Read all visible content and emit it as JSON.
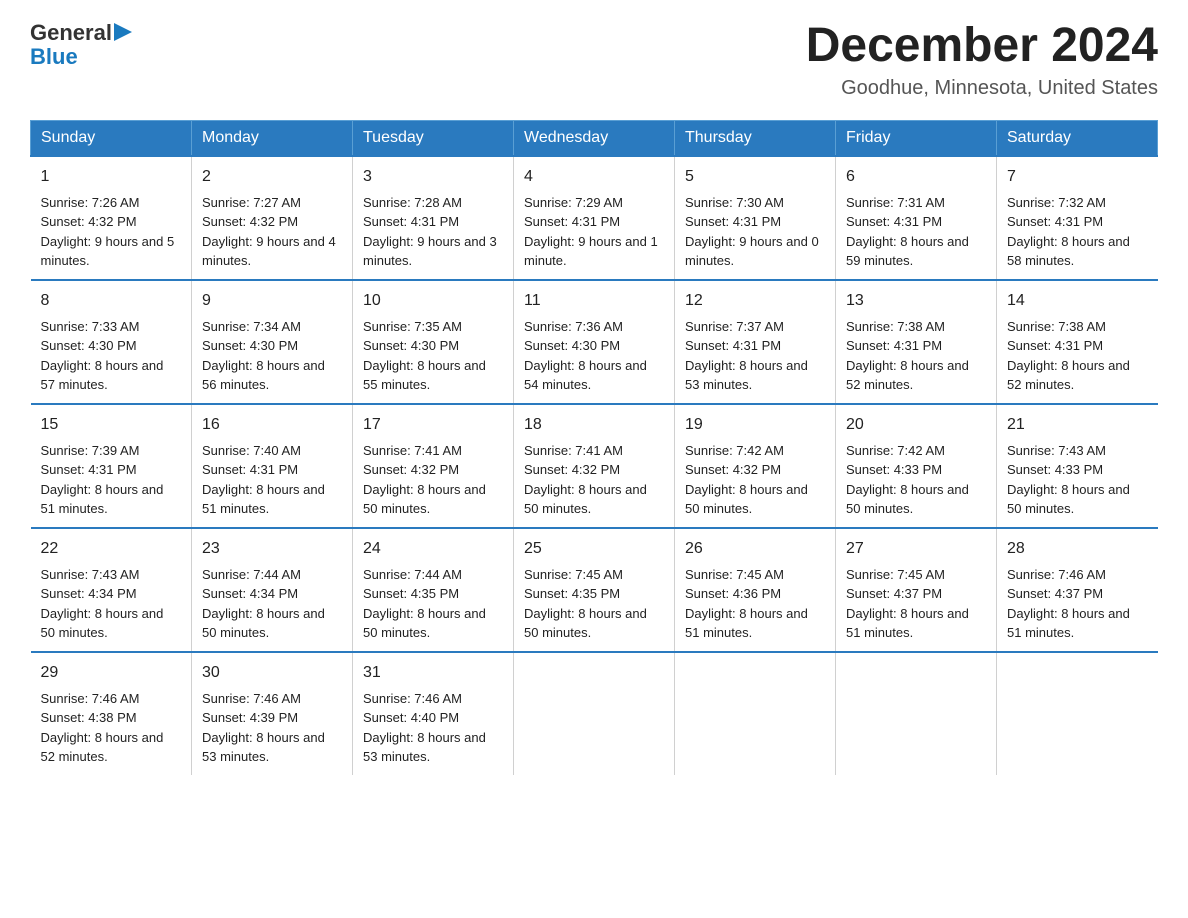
{
  "logo": {
    "general": "General",
    "blue": "Blue",
    "triangle": "▶"
  },
  "title": "December 2024",
  "subtitle": "Goodhue, Minnesota, United States",
  "days_of_week": [
    "Sunday",
    "Monday",
    "Tuesday",
    "Wednesday",
    "Thursday",
    "Friday",
    "Saturday"
  ],
  "weeks": [
    [
      {
        "day": "1",
        "sunrise": "7:26 AM",
        "sunset": "4:32 PM",
        "daylight": "9 hours and 5 minutes."
      },
      {
        "day": "2",
        "sunrise": "7:27 AM",
        "sunset": "4:32 PM",
        "daylight": "9 hours and 4 minutes."
      },
      {
        "day": "3",
        "sunrise": "7:28 AM",
        "sunset": "4:31 PM",
        "daylight": "9 hours and 3 minutes."
      },
      {
        "day": "4",
        "sunrise": "7:29 AM",
        "sunset": "4:31 PM",
        "daylight": "9 hours and 1 minute."
      },
      {
        "day": "5",
        "sunrise": "7:30 AM",
        "sunset": "4:31 PM",
        "daylight": "9 hours and 0 minutes."
      },
      {
        "day": "6",
        "sunrise": "7:31 AM",
        "sunset": "4:31 PM",
        "daylight": "8 hours and 59 minutes."
      },
      {
        "day": "7",
        "sunrise": "7:32 AM",
        "sunset": "4:31 PM",
        "daylight": "8 hours and 58 minutes."
      }
    ],
    [
      {
        "day": "8",
        "sunrise": "7:33 AM",
        "sunset": "4:30 PM",
        "daylight": "8 hours and 57 minutes."
      },
      {
        "day": "9",
        "sunrise": "7:34 AM",
        "sunset": "4:30 PM",
        "daylight": "8 hours and 56 minutes."
      },
      {
        "day": "10",
        "sunrise": "7:35 AM",
        "sunset": "4:30 PM",
        "daylight": "8 hours and 55 minutes."
      },
      {
        "day": "11",
        "sunrise": "7:36 AM",
        "sunset": "4:30 PM",
        "daylight": "8 hours and 54 minutes."
      },
      {
        "day": "12",
        "sunrise": "7:37 AM",
        "sunset": "4:31 PM",
        "daylight": "8 hours and 53 minutes."
      },
      {
        "day": "13",
        "sunrise": "7:38 AM",
        "sunset": "4:31 PM",
        "daylight": "8 hours and 52 minutes."
      },
      {
        "day": "14",
        "sunrise": "7:38 AM",
        "sunset": "4:31 PM",
        "daylight": "8 hours and 52 minutes."
      }
    ],
    [
      {
        "day": "15",
        "sunrise": "7:39 AM",
        "sunset": "4:31 PM",
        "daylight": "8 hours and 51 minutes."
      },
      {
        "day": "16",
        "sunrise": "7:40 AM",
        "sunset": "4:31 PM",
        "daylight": "8 hours and 51 minutes."
      },
      {
        "day": "17",
        "sunrise": "7:41 AM",
        "sunset": "4:32 PM",
        "daylight": "8 hours and 50 minutes."
      },
      {
        "day": "18",
        "sunrise": "7:41 AM",
        "sunset": "4:32 PM",
        "daylight": "8 hours and 50 minutes."
      },
      {
        "day": "19",
        "sunrise": "7:42 AM",
        "sunset": "4:32 PM",
        "daylight": "8 hours and 50 minutes."
      },
      {
        "day": "20",
        "sunrise": "7:42 AM",
        "sunset": "4:33 PM",
        "daylight": "8 hours and 50 minutes."
      },
      {
        "day": "21",
        "sunrise": "7:43 AM",
        "sunset": "4:33 PM",
        "daylight": "8 hours and 50 minutes."
      }
    ],
    [
      {
        "day": "22",
        "sunrise": "7:43 AM",
        "sunset": "4:34 PM",
        "daylight": "8 hours and 50 minutes."
      },
      {
        "day": "23",
        "sunrise": "7:44 AM",
        "sunset": "4:34 PM",
        "daylight": "8 hours and 50 minutes."
      },
      {
        "day": "24",
        "sunrise": "7:44 AM",
        "sunset": "4:35 PM",
        "daylight": "8 hours and 50 minutes."
      },
      {
        "day": "25",
        "sunrise": "7:45 AM",
        "sunset": "4:35 PM",
        "daylight": "8 hours and 50 minutes."
      },
      {
        "day": "26",
        "sunrise": "7:45 AM",
        "sunset": "4:36 PM",
        "daylight": "8 hours and 51 minutes."
      },
      {
        "day": "27",
        "sunrise": "7:45 AM",
        "sunset": "4:37 PM",
        "daylight": "8 hours and 51 minutes."
      },
      {
        "day": "28",
        "sunrise": "7:46 AM",
        "sunset": "4:37 PM",
        "daylight": "8 hours and 51 minutes."
      }
    ],
    [
      {
        "day": "29",
        "sunrise": "7:46 AM",
        "sunset": "4:38 PM",
        "daylight": "8 hours and 52 minutes."
      },
      {
        "day": "30",
        "sunrise": "7:46 AM",
        "sunset": "4:39 PM",
        "daylight": "8 hours and 53 minutes."
      },
      {
        "day": "31",
        "sunrise": "7:46 AM",
        "sunset": "4:40 PM",
        "daylight": "8 hours and 53 minutes."
      },
      {
        "day": "",
        "sunrise": "",
        "sunset": "",
        "daylight": ""
      },
      {
        "day": "",
        "sunrise": "",
        "sunset": "",
        "daylight": ""
      },
      {
        "day": "",
        "sunrise": "",
        "sunset": "",
        "daylight": ""
      },
      {
        "day": "",
        "sunrise": "",
        "sunset": "",
        "daylight": ""
      }
    ]
  ]
}
